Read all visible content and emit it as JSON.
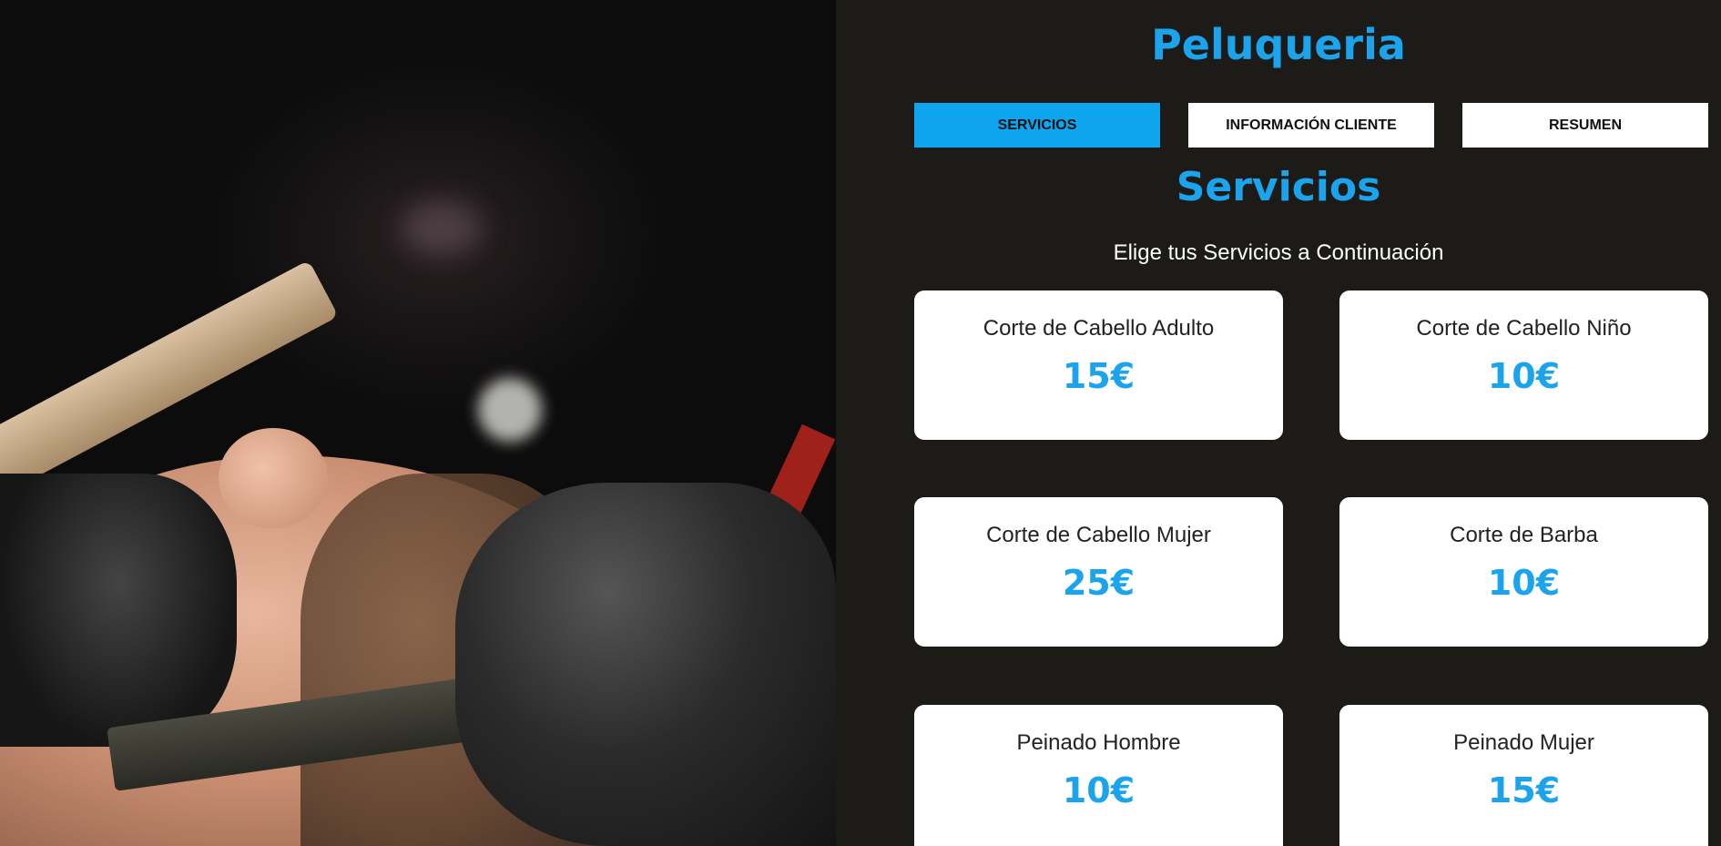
{
  "header": {
    "title": "Peluqueria"
  },
  "tabs": [
    {
      "label": "SERVICIOS",
      "active": true
    },
    {
      "label": "INFORMACIÓN CLIENTE",
      "active": false
    },
    {
      "label": "RESUMEN",
      "active": false
    }
  ],
  "section": {
    "title": "Servicios",
    "subtitle": "Elige tus Servicios a Continuación"
  },
  "services": [
    {
      "name": "Corte de Cabello Adulto",
      "price": "15€"
    },
    {
      "name": "Corte de Cabello Niño",
      "price": "10€"
    },
    {
      "name": "Corte de Cabello Mujer",
      "price": "25€"
    },
    {
      "name": "Corte de Barba",
      "price": "10€"
    },
    {
      "name": "Peinado Hombre",
      "price": "10€"
    },
    {
      "name": "Peinado Mujer",
      "price": "15€"
    }
  ],
  "colors": {
    "accent": "#1ba3ec",
    "background": "#1c1b18",
    "card": "#ffffff"
  }
}
